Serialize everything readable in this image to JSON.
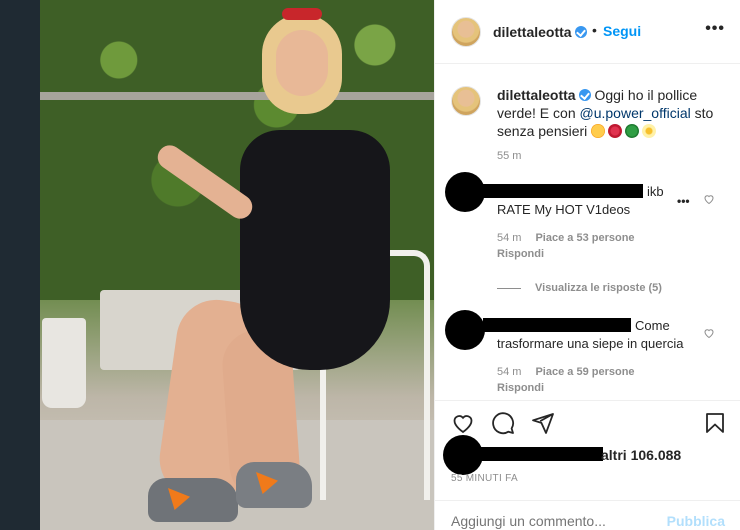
{
  "post": {
    "username": "dilettaleotta",
    "follow_label": "Segui",
    "dot": "•",
    "more_label": "•••",
    "caption": {
      "username": "dilettaleotta",
      "text_before": "Oggi ho il pollice verde! E con",
      "mention": "@u.power_official",
      "text_after": "sto senza pensieri",
      "emojis": [
        "relieved-face",
        "hibiscus",
        "four-leaf-clover",
        "blossom"
      ],
      "time": "55 m"
    },
    "comments": [
      {
        "tail": "ikb",
        "body": "RATE My HOT V1deos",
        "time": "54 m",
        "likes": "Piace a 53 persone",
        "reply": "Rispondi",
        "more": "•••"
      },
      {
        "tail": "Come",
        "body": "trasformare una siepe in quercia",
        "time": "54 m",
        "likes": "Piace a 59 persone",
        "reply": "Rispondi"
      }
    ],
    "view_replies": "Visualizza le risposte (5)",
    "likes_text": "altri 106.088",
    "post_time": "55 MINUTI FA",
    "add_comment_placeholder": "Aggiungi un commento...",
    "publish_label": "Pubblica"
  },
  "colors": {
    "link_blue": "#0095f6",
    "verified_blue": "#3897f0",
    "meta_gray": "#8e8e8e",
    "publish_disabled": "#b2dffc"
  }
}
